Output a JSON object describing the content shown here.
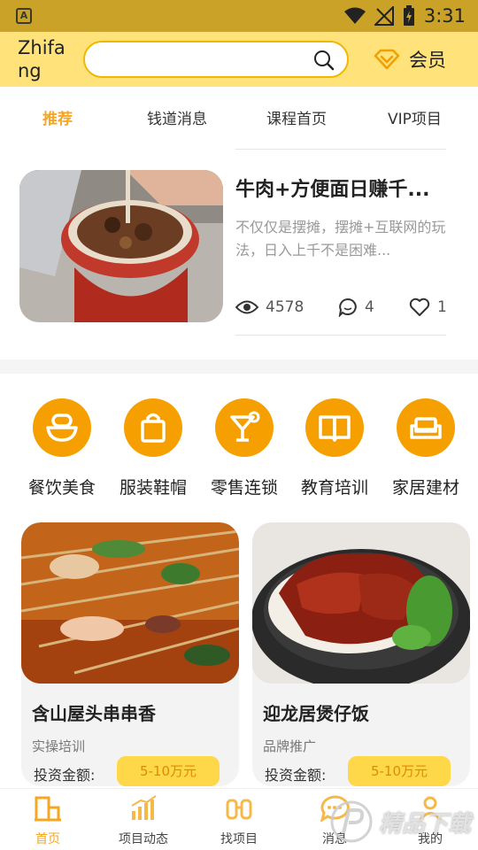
{
  "status_bar": {
    "time": "3:31"
  },
  "header": {
    "brand": "Zhifang",
    "search": {
      "value": "",
      "placeholder": ""
    },
    "vip_label": "会员"
  },
  "tabs": [
    "推荐",
    "钱道消息",
    "课程首页",
    "VIP项目"
  ],
  "featured_article": {
    "title": "牛肉+方便面日赚千...",
    "description": "不仅仅是摆摊，摆摊+互联网的玩法，日入上千不是困难...",
    "views": "4578",
    "comments": "4",
    "likes": "1"
  },
  "categories": [
    "餐饮美食",
    "服装鞋帽",
    "零售连锁",
    "教育培训",
    "家居建材"
  ],
  "projects": [
    {
      "title": "含山屋头串串香",
      "tag": "实操培训",
      "amount_label": "投资金额:",
      "amount": "5-10万元"
    },
    {
      "title": "迎龙居煲仔饭",
      "tag": "品牌推广",
      "amount_label": "投资金额:",
      "amount": "5-10万元"
    }
  ],
  "bottom_nav": [
    "首页",
    "项目动态",
    "找项目",
    "消息",
    "我的"
  ],
  "watermark": "精品下载",
  "colors": {
    "accent": "#f5a623",
    "header_bg": "#ffe27a",
    "status_bg": "#c9a227",
    "category_circle": "#f5a000",
    "amount_pill": "#ffd84a"
  }
}
